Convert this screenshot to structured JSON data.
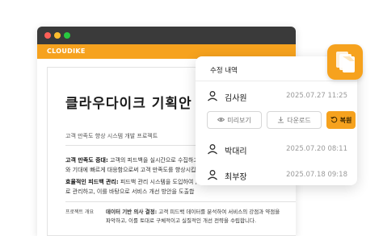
{
  "app": {
    "brand": "CLOUDIKE"
  },
  "document": {
    "title": "클라우다이크 기획안",
    "subtitle": "고객 만족도 향상 시스템 개발 프로젝트",
    "lines": [
      {
        "bold": "고객 만족도 증대:",
        "text": " 고객의 피드백을 실시간으로 수집하고"
      },
      {
        "bold": "",
        "text": "와 기대에 빠르게 대응함으로써 고객 만족도를 향상시킵"
      },
      {
        "bold": "효율적인 피드백 관리:",
        "text": " 피드백 관리 시스템을 도입하여 ,"
      },
      {
        "bold": "",
        "text": "로 관리하고, 이를 바탕으로 서비스 개선 방안을 도출합"
      }
    ],
    "section_label": "프로젝트 개요",
    "section_lines": [
      {
        "bold": "데이터 기반 의사 결정:",
        "text": " 고객 피드백 데이터를 분석하여 서비스의 강점과 약점을"
      },
      {
        "bold": "",
        "text": "파악하고, 이를 토대로 구체적이고 실질적인 개선 전략을 수립합니다."
      }
    ]
  },
  "revision_panel": {
    "title": "수정 내역",
    "entries": [
      {
        "name": "김사원",
        "date": "2025.07.27 11:25"
      },
      {
        "name": "박대리",
        "date": "2025.07.20 08:11"
      },
      {
        "name": "최부장",
        "date": "2025.07.18 09:18"
      }
    ],
    "actions": {
      "preview": "미리보기",
      "download": "다운로드",
      "restore": "복원"
    }
  },
  "colors": {
    "accent": "#f6a21e",
    "titlebar": "#3a3a3a",
    "date_text": "#9a9a9a"
  },
  "icons": [
    "user-icon",
    "eye-icon",
    "download-icon",
    "restore-icon",
    "documents-icon"
  ]
}
